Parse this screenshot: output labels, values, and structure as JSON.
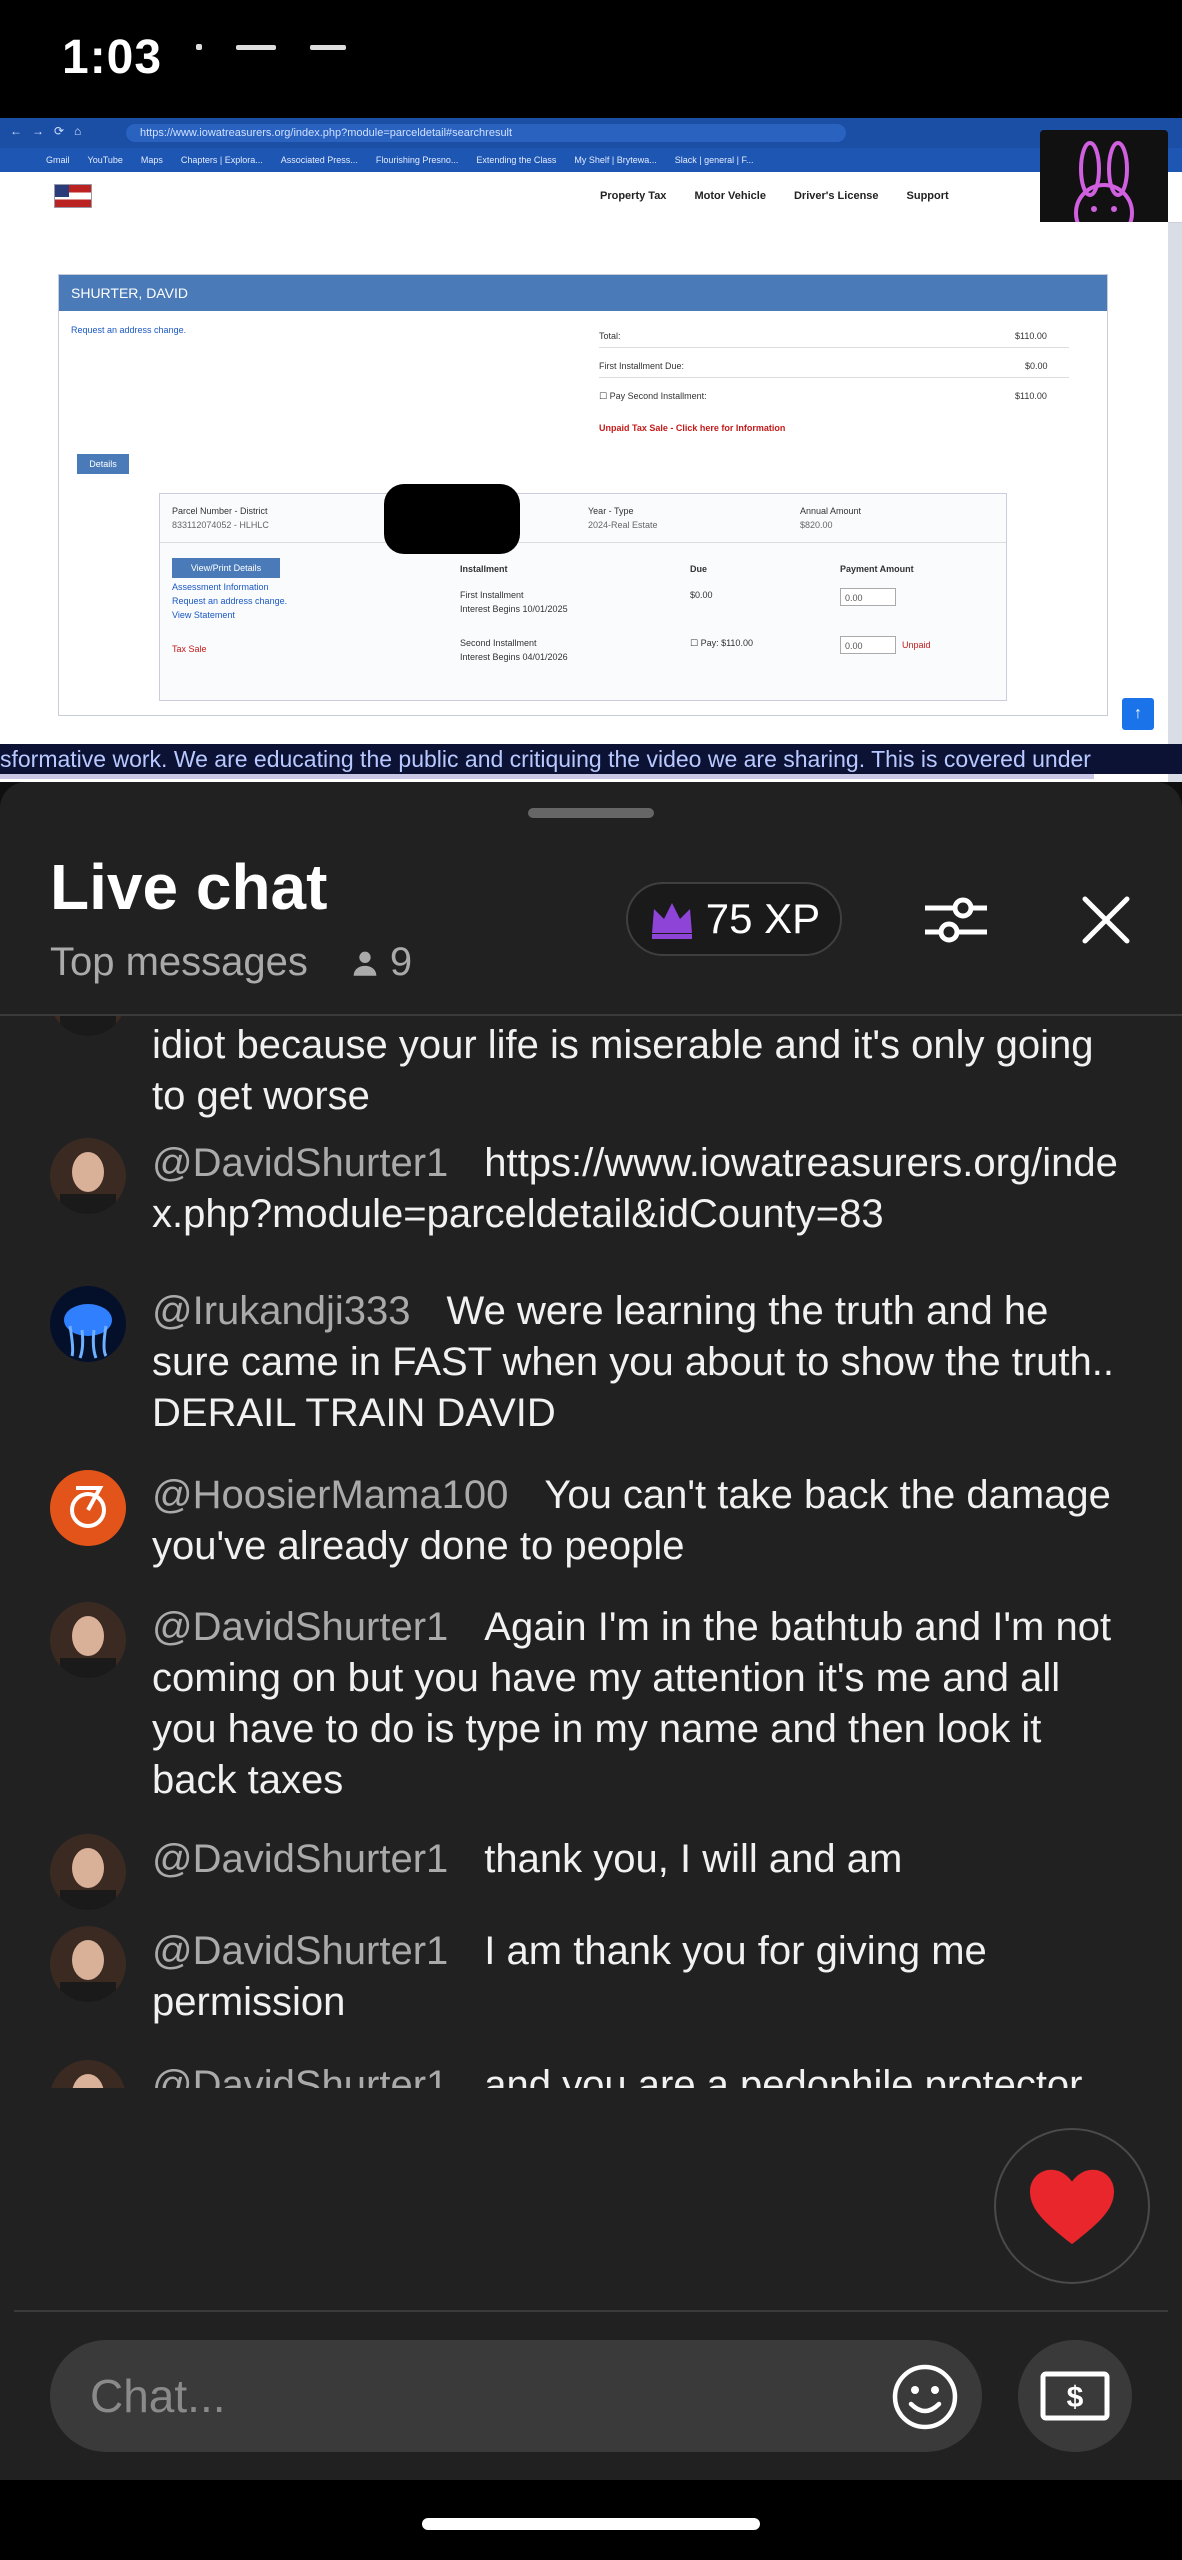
{
  "status_bar": {
    "time": "1:03"
  },
  "video": {
    "url": "https://www.iowatreasurers.org/index.php?module=parceldetail#searchresult",
    "bookmarks": [
      "Gmail",
      "YouTube",
      "Maps",
      "Chapters | Explora...",
      "Associated Press...",
      "Flourishing Presno...",
      "Extending the Class",
      "My Shelf | Brytewa...",
      "Slack | general | F..."
    ],
    "site_nav": [
      "Property Tax",
      "Motor Vehicle",
      "Driver's License",
      "Support"
    ],
    "owner_name": "SHURTER, DAVID",
    "address_link": "Request an address change.",
    "total_label": "Total:",
    "total_value": "$110.00",
    "first_due_label": "First Installment Due:",
    "first_due_value": "$0.00",
    "pay_second_label": "Pay Second Installment:",
    "pay_second_value": "$110.00",
    "unpaid_link": "Unpaid Tax Sale - Click here for Information",
    "details_label": "Details",
    "parcel_header": "Parcel Number - District",
    "parcel_value": "833112074052 - HLHLC",
    "year_header": "Year - Type",
    "year_value": "2024-Real Estate",
    "annual_header": "Annual Amount",
    "annual_value": "$820.00",
    "view_print": "View/Print Details",
    "assessment_link": "Assessment Information",
    "address_link2": "Request an address change.",
    "statement_link": "View Statement",
    "tax_sale": "Tax Sale",
    "col_installment": "Installment",
    "col_due": "Due",
    "col_payment": "Payment Amount",
    "inst1_name": "First Installment",
    "inst1_interest": "Interest Begins 10/01/2025",
    "inst1_due": "$0.00",
    "inst1_amount": "0.00",
    "inst2_name": "Second Installment",
    "inst2_interest": "Interest Begins 04/01/2026",
    "inst2_pay": "Pay: $110.00",
    "inst2_amount": "0.00",
    "inst2_status": "Unpaid",
    "ticker": "sformative work. We are educating the public and critiquing the video we are sharing. This is covered under"
  },
  "chat": {
    "title": "Live chat",
    "mode": "Top messages",
    "viewer_count": "9",
    "xp": "75 XP",
    "input_placeholder": "Chat...",
    "messages": [
      {
        "author": "",
        "text": "idiot because your life is miserable and it's only going to get worse",
        "avatar": "bald-man"
      },
      {
        "author": "@DavidShurter1",
        "text": "https://www.iowatreasurers.org/index.php?module=parceldetail&idCounty=83",
        "avatar": "bald-man"
      },
      {
        "author": "@Irukandji333",
        "text": "We were learning the truth and he sure came in FAST when you about to show the truth.. DERAIL TRAIN DAVID",
        "avatar": "jellyfish"
      },
      {
        "author": "@HoosierMama100",
        "text": "You can't take back the damage you've already done to people",
        "avatar": "logo-orange"
      },
      {
        "author": "@DavidShurter1",
        "text": "Again I'm in the bathtub and I'm not coming on but you have my attention it's me and all you have to do is type in my name and then look it back taxes",
        "avatar": "bald-man"
      },
      {
        "author": "@DavidShurter1",
        "text": "thank you, I will and am",
        "avatar": "bald-man"
      },
      {
        "author": "@DavidShurter1",
        "text": "I am thank you for giving me permission",
        "avatar": "bald-man"
      },
      {
        "author": "@DavidShurter1",
        "text": "and you are a pedophile protector who's involved with a bunch of pedophiles who are involved with the pedophi operation",
        "avatar": "bald-man"
      }
    ]
  }
}
